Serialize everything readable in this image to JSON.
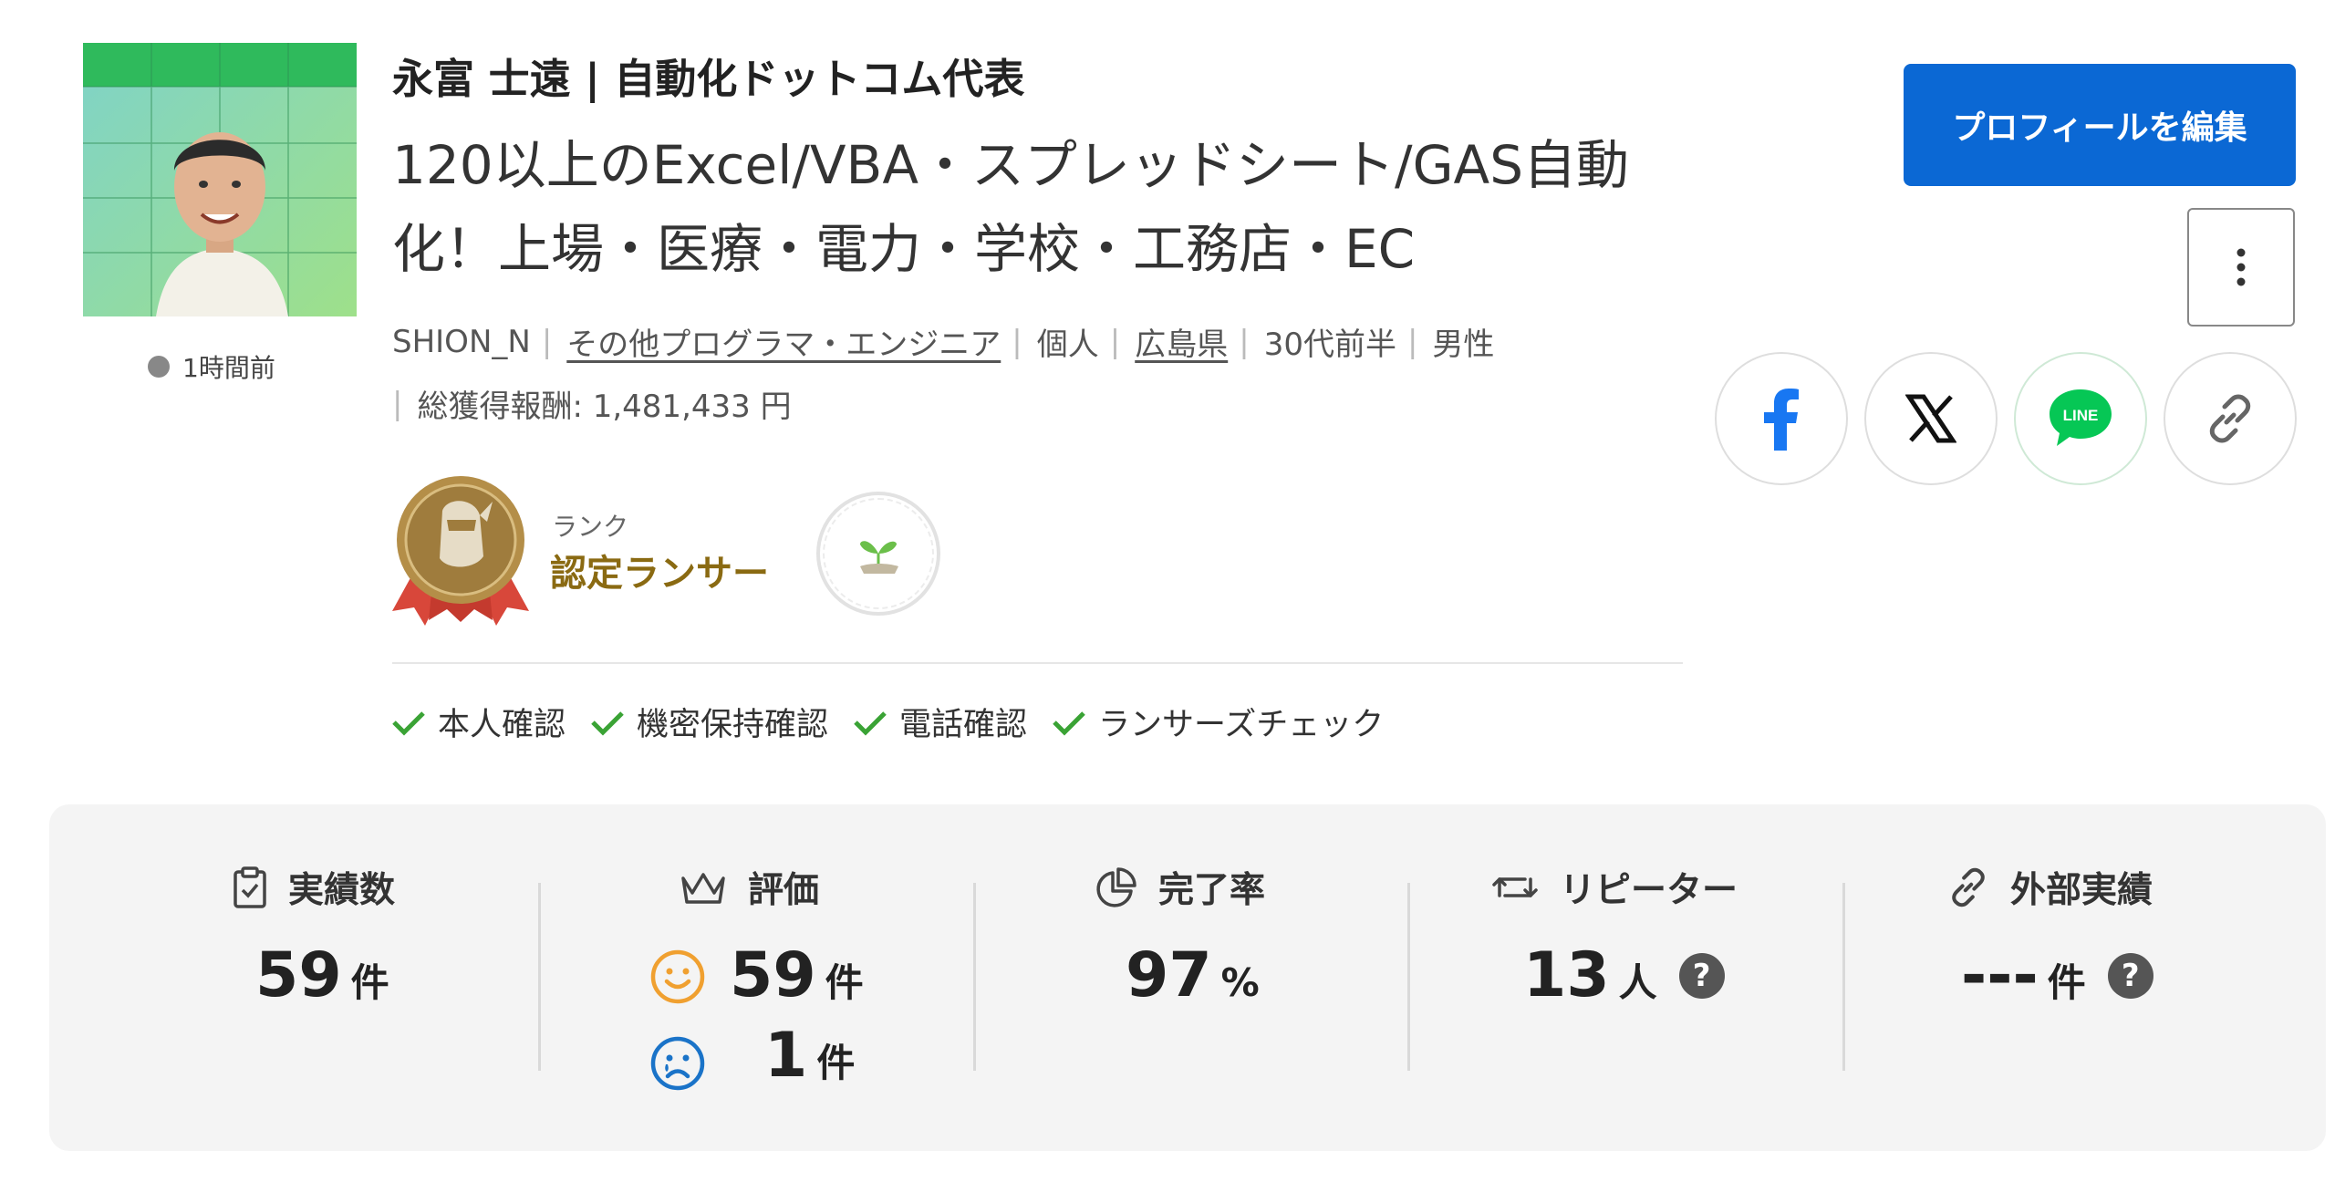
{
  "profile": {
    "name": "永富 士遠 | 自動化ドットコム代表",
    "catchphrase": "120以上のExcel/VBA・スプレッドシート/GAS自動化！上場・医療・電力・学校・工務店・EC",
    "last_active": "1時間前",
    "username": "SHION_N",
    "occupation": "その他プログラマ・エンジニア",
    "type": "個人",
    "prefecture": "広島県",
    "age": "30代前半",
    "gender": "男性",
    "earnings_label": "総獲得報酬: 1,481,433 円"
  },
  "rank": {
    "label": "ランク",
    "name": "認定ランサー"
  },
  "verifications": [
    "本人確認",
    "機密保持確認",
    "電話確認",
    "ランサーズチェック"
  ],
  "actions": {
    "edit_label": "プロフィールを編集",
    "more_icon": "more-vertical-icon",
    "share": [
      "facebook-icon",
      "x-icon",
      "line-icon",
      "copy-link-icon"
    ],
    "line_text": "LINE"
  },
  "stats": {
    "achievements": {
      "label": "実績数",
      "value": "59",
      "unit": "件"
    },
    "rating": {
      "label": "評価",
      "good": "59",
      "bad": "1",
      "unit": "件"
    },
    "completion": {
      "label": "完了率",
      "value": "97",
      "unit": "%"
    },
    "repeaters": {
      "label": "リピーター",
      "value": "13",
      "unit": "人",
      "help": "?"
    },
    "external": {
      "label": "外部実績",
      "value": "---",
      "unit": "件",
      "help": "?"
    }
  },
  "colors": {
    "primary": "#0b68d4",
    "rank_gold": "#8a6a12",
    "check_green": "#3aa335",
    "line_green": "#06c755",
    "facebook_blue": "#1877f2",
    "smile_orange": "#f0a030",
    "sad_blue": "#1a73c8"
  }
}
